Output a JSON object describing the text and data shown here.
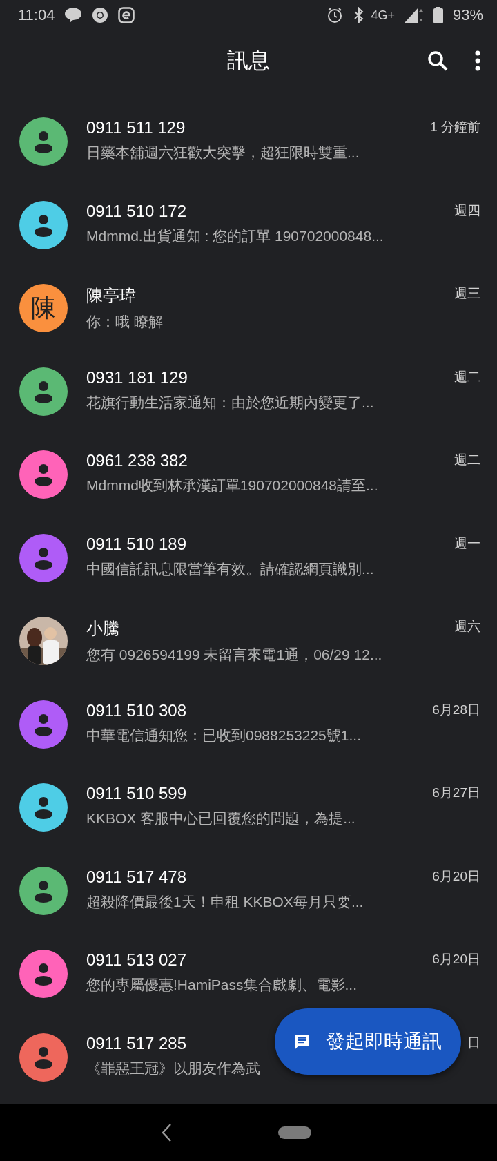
{
  "status_bar": {
    "time": "11:04",
    "network": "4G+",
    "battery": "93%"
  },
  "header": {
    "title": "訊息"
  },
  "conversations": [
    {
      "name": "0911 511 129",
      "preview": "日藥本舖週六狂歡大突擊，超狂限時雙重...",
      "time": "1 分鐘前",
      "avatar": {
        "kind": "person",
        "color": "#5bb974"
      }
    },
    {
      "name": "0911 510 172",
      "preview": "Mdmmd.出貨通知 : 您的訂單 190702000848...",
      "time": "週四",
      "avatar": {
        "kind": "person",
        "color": "#4ecde6"
      }
    },
    {
      "name": "陳亭瑋",
      "preview": "你：哦 瞭解",
      "time": "週三",
      "avatar": {
        "kind": "letter",
        "color": "#fa903e",
        "letter": "陳"
      }
    },
    {
      "name": "0931 181 129",
      "preview": "花旗行動生活家通知：由於您近期內變更了...",
      "time": "週二",
      "avatar": {
        "kind": "person",
        "color": "#5bb974"
      }
    },
    {
      "name": "0961 238 382",
      "preview": "Mdmmd收到林承漢訂單190702000848請至...",
      "time": "週二",
      "avatar": {
        "kind": "person",
        "color": "#ff63b8"
      }
    },
    {
      "name": "0911 510 189",
      "preview": "中國信託訊息限當筆有效。請確認網頁識別...",
      "time": "週一",
      "avatar": {
        "kind": "person",
        "color": "#af5cf7"
      }
    },
    {
      "name": "小騰",
      "preview": "您有 0926594199 未留言來電1通，06/29 12...",
      "time": "週六"
    },
    {
      "name": "0911 510 308",
      "preview": "中華電信通知您：已收到0988253225號1...",
      "time": "6月28日",
      "avatar": {
        "kind": "person",
        "color": "#af5cf7"
      }
    },
    {
      "name": "0911 510 599",
      "preview": "KKBOX 客服中心已回覆您的問題，為提...",
      "time": "6月27日",
      "avatar": {
        "kind": "person",
        "color": "#4ecde6"
      }
    },
    {
      "name": "0911 517 478",
      "preview": "超殺降價最後1天！申租 KKBOX每月只要...",
      "time": "6月20日",
      "avatar": {
        "kind": "person",
        "color": "#5bb974"
      }
    },
    {
      "name": "0911 513 027",
      "preview": "您的專屬優惠!HamiPass集合戲劇、電影...",
      "time": "6月20日",
      "avatar": {
        "kind": "person",
        "color": "#ff63b8"
      }
    },
    {
      "name": "0911 517 285",
      "preview": "《罪惡王冠》以朋友作為武",
      "time": "日",
      "avatar": {
        "kind": "person",
        "color": "#ee675c"
      }
    }
  ],
  "fab": {
    "label": "發起即時通訊"
  }
}
